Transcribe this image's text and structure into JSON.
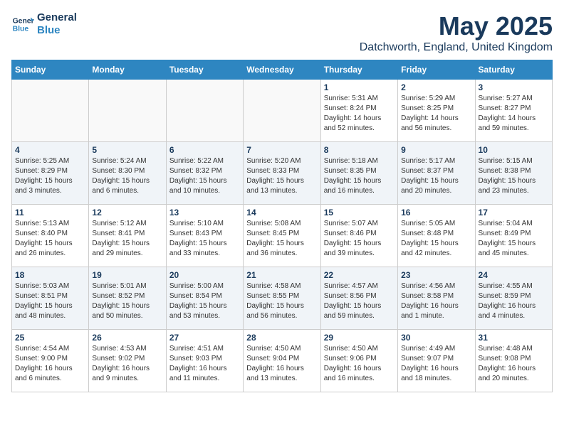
{
  "header": {
    "logo_line1": "General",
    "logo_line2": "Blue",
    "title": "May 2025",
    "subtitle": "Datchworth, England, United Kingdom"
  },
  "weekdays": [
    "Sunday",
    "Monday",
    "Tuesday",
    "Wednesday",
    "Thursday",
    "Friday",
    "Saturday"
  ],
  "weeks": [
    [
      {
        "day": "",
        "info": ""
      },
      {
        "day": "",
        "info": ""
      },
      {
        "day": "",
        "info": ""
      },
      {
        "day": "",
        "info": ""
      },
      {
        "day": "1",
        "info": "Sunrise: 5:31 AM\nSunset: 8:24 PM\nDaylight: 14 hours\nand 52 minutes."
      },
      {
        "day": "2",
        "info": "Sunrise: 5:29 AM\nSunset: 8:25 PM\nDaylight: 14 hours\nand 56 minutes."
      },
      {
        "day": "3",
        "info": "Sunrise: 5:27 AM\nSunset: 8:27 PM\nDaylight: 14 hours\nand 59 minutes."
      }
    ],
    [
      {
        "day": "4",
        "info": "Sunrise: 5:25 AM\nSunset: 8:29 PM\nDaylight: 15 hours\nand 3 minutes."
      },
      {
        "day": "5",
        "info": "Sunrise: 5:24 AM\nSunset: 8:30 PM\nDaylight: 15 hours\nand 6 minutes."
      },
      {
        "day": "6",
        "info": "Sunrise: 5:22 AM\nSunset: 8:32 PM\nDaylight: 15 hours\nand 10 minutes."
      },
      {
        "day": "7",
        "info": "Sunrise: 5:20 AM\nSunset: 8:33 PM\nDaylight: 15 hours\nand 13 minutes."
      },
      {
        "day": "8",
        "info": "Sunrise: 5:18 AM\nSunset: 8:35 PM\nDaylight: 15 hours\nand 16 minutes."
      },
      {
        "day": "9",
        "info": "Sunrise: 5:17 AM\nSunset: 8:37 PM\nDaylight: 15 hours\nand 20 minutes."
      },
      {
        "day": "10",
        "info": "Sunrise: 5:15 AM\nSunset: 8:38 PM\nDaylight: 15 hours\nand 23 minutes."
      }
    ],
    [
      {
        "day": "11",
        "info": "Sunrise: 5:13 AM\nSunset: 8:40 PM\nDaylight: 15 hours\nand 26 minutes."
      },
      {
        "day": "12",
        "info": "Sunrise: 5:12 AM\nSunset: 8:41 PM\nDaylight: 15 hours\nand 29 minutes."
      },
      {
        "day": "13",
        "info": "Sunrise: 5:10 AM\nSunset: 8:43 PM\nDaylight: 15 hours\nand 33 minutes."
      },
      {
        "day": "14",
        "info": "Sunrise: 5:08 AM\nSunset: 8:45 PM\nDaylight: 15 hours\nand 36 minutes."
      },
      {
        "day": "15",
        "info": "Sunrise: 5:07 AM\nSunset: 8:46 PM\nDaylight: 15 hours\nand 39 minutes."
      },
      {
        "day": "16",
        "info": "Sunrise: 5:05 AM\nSunset: 8:48 PM\nDaylight: 15 hours\nand 42 minutes."
      },
      {
        "day": "17",
        "info": "Sunrise: 5:04 AM\nSunset: 8:49 PM\nDaylight: 15 hours\nand 45 minutes."
      }
    ],
    [
      {
        "day": "18",
        "info": "Sunrise: 5:03 AM\nSunset: 8:51 PM\nDaylight: 15 hours\nand 48 minutes."
      },
      {
        "day": "19",
        "info": "Sunrise: 5:01 AM\nSunset: 8:52 PM\nDaylight: 15 hours\nand 50 minutes."
      },
      {
        "day": "20",
        "info": "Sunrise: 5:00 AM\nSunset: 8:54 PM\nDaylight: 15 hours\nand 53 minutes."
      },
      {
        "day": "21",
        "info": "Sunrise: 4:58 AM\nSunset: 8:55 PM\nDaylight: 15 hours\nand 56 minutes."
      },
      {
        "day": "22",
        "info": "Sunrise: 4:57 AM\nSunset: 8:56 PM\nDaylight: 15 hours\nand 59 minutes."
      },
      {
        "day": "23",
        "info": "Sunrise: 4:56 AM\nSunset: 8:58 PM\nDaylight: 16 hours\nand 1 minute."
      },
      {
        "day": "24",
        "info": "Sunrise: 4:55 AM\nSunset: 8:59 PM\nDaylight: 16 hours\nand 4 minutes."
      }
    ],
    [
      {
        "day": "25",
        "info": "Sunrise: 4:54 AM\nSunset: 9:00 PM\nDaylight: 16 hours\nand 6 minutes."
      },
      {
        "day": "26",
        "info": "Sunrise: 4:53 AM\nSunset: 9:02 PM\nDaylight: 16 hours\nand 9 minutes."
      },
      {
        "day": "27",
        "info": "Sunrise: 4:51 AM\nSunset: 9:03 PM\nDaylight: 16 hours\nand 11 minutes."
      },
      {
        "day": "28",
        "info": "Sunrise: 4:50 AM\nSunset: 9:04 PM\nDaylight: 16 hours\nand 13 minutes."
      },
      {
        "day": "29",
        "info": "Sunrise: 4:50 AM\nSunset: 9:06 PM\nDaylight: 16 hours\nand 16 minutes."
      },
      {
        "day": "30",
        "info": "Sunrise: 4:49 AM\nSunset: 9:07 PM\nDaylight: 16 hours\nand 18 minutes."
      },
      {
        "day": "31",
        "info": "Sunrise: 4:48 AM\nSunset: 9:08 PM\nDaylight: 16 hours\nand 20 minutes."
      }
    ]
  ]
}
